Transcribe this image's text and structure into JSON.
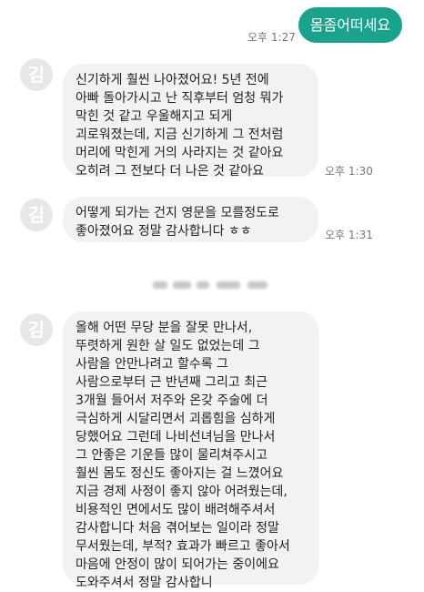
{
  "messages": {
    "outgoing": {
      "text": "몸좀어떠세요",
      "time": "오후 1:27"
    },
    "incoming": [
      {
        "avatar": "김",
        "lines": [
          "신기하게 훨씬 나아졌어요! 5년 전에",
          "아빠 돌아가시고 난 직후부터 엄청 뭐가",
          "막힌 것 같고 우울해지고 되게",
          "괴로워졌는데, 지금 신기하게 그 전처럼",
          "머리에 막힌게 거의 사라지는 것 같아요",
          "오히려 그 전보다 더 나은 것 같아요"
        ],
        "time": "오후 1:30"
      },
      {
        "lines": [
          "어떻게 되가는 건지 영문을 모를정도로",
          "좋아졌어요 정말 감사합니다 ㅎㅎ"
        ],
        "time": "오후 1:31"
      },
      {
        "avatar": "김",
        "lines": [
          "올해 어떤 무당 분을 잘못 만나서,",
          "뚜렷하게 원한 살 일도 없었는데 그",
          "사람을 안만나려고 할수록 그",
          "사람으로부터 근 반년째 그리고 최근",
          "3개월 들어서 저주와 온갖 주술에 더",
          "극심하게 시달리면서 괴롭힘을 심하게",
          "당했어요 그런데 나비선녀님을 만나서",
          "그 안좋은 기운들 많이 물리쳐주시고",
          "훨씬 몸도 정신도 좋아지는 걸 느꼈어요",
          "지금 경제 사정이 좋지 않아 어려웠는데,",
          "비용적인 면에서도 많이 배려해주셔서",
          "감사합니다 처음 겪어보는 일이라 정말",
          "무서웠는데, 부적? 효과가 빠르고 좋아서",
          "마음에 안정이 많이 되어가는 중이에요",
          "도와주셔서 정말 감사합니"
        ]
      }
    ]
  },
  "colors": {
    "outgoing_bubble": "#1aa38c",
    "incoming_bubble": "#f2f2f2",
    "avatar_bg": "#e7e7e7",
    "time_text": "#777777"
  }
}
